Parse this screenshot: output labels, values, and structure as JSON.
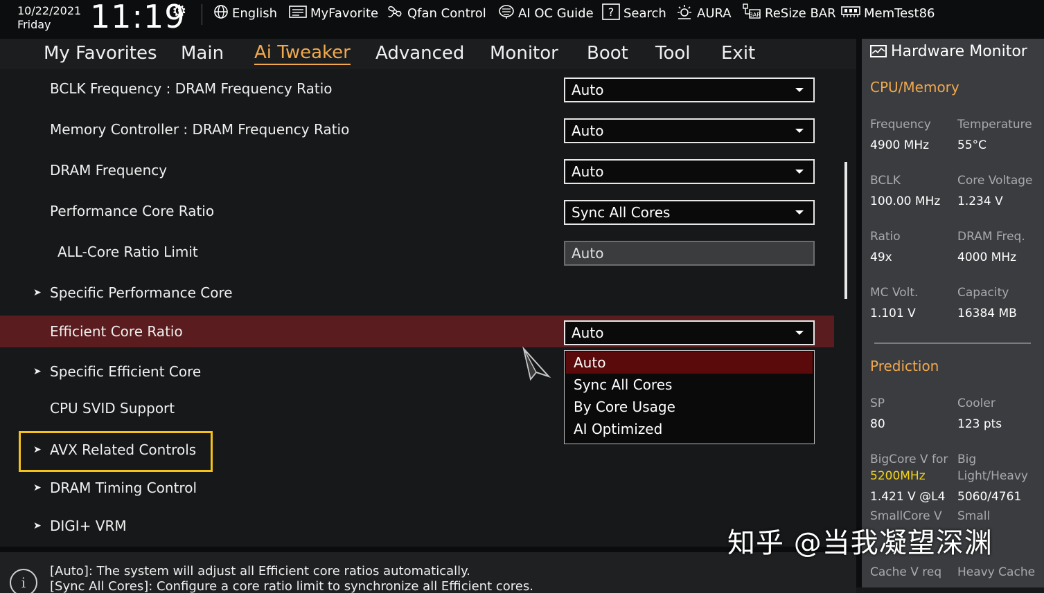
{
  "topbar": {
    "date": "10/22/2021",
    "day": "Friday",
    "time": "11:19",
    "items": [
      {
        "icon": "globe-icon",
        "label": "English"
      },
      {
        "icon": "favorite-list-icon",
        "label": "MyFavorite"
      },
      {
        "icon": "fan-icon",
        "label": "Qfan Control"
      },
      {
        "icon": "ai-brain-icon",
        "label": "AI OC Guide"
      },
      {
        "icon": "help-search-icon",
        "label": "Search"
      },
      {
        "icon": "aura-light-icon",
        "label": "AURA"
      },
      {
        "icon": "resize-bar-icon",
        "label": "ReSize BAR"
      },
      {
        "icon": "memtest-icon",
        "label": "MemTest86"
      }
    ]
  },
  "tabs": [
    "My Favorites",
    "Main",
    "Ai Tweaker",
    "Advanced",
    "Monitor",
    "Boot",
    "Tool",
    "Exit"
  ],
  "active_tab": "Ai Tweaker",
  "settings": [
    {
      "label": "BCLK Frequency : DRAM Frequency Ratio",
      "value": "Auto"
    },
    {
      "label": "Memory Controller : DRAM Frequency Ratio",
      "value": "Auto"
    },
    {
      "label": "DRAM Frequency",
      "value": "Auto"
    },
    {
      "label": "Performance Core Ratio",
      "value": "Sync All Cores"
    },
    {
      "label": "ALL-Core Ratio Limit",
      "value": "Auto"
    },
    {
      "label": "Specific Performance Core"
    },
    {
      "label": "Efficient Core Ratio",
      "value": "Auto"
    },
    {
      "label": "Specific Efficient Core"
    },
    {
      "label": "CPU SVID Support"
    },
    {
      "label": "AVX Related Controls"
    },
    {
      "label": "DRAM Timing Control"
    },
    {
      "label": "DIGI+ VRM"
    }
  ],
  "dropdown_options": [
    "Auto",
    "Sync All Cores",
    "By Core Usage",
    "AI Optimized"
  ],
  "dropdown_selected": "Auto",
  "help": [
    "[Auto]: The system will adjust all Efficient core ratios automatically.",
    "[Sync All Cores]: Configure a core ratio limit to synchronize all Efficient cores."
  ],
  "hw": {
    "title": "Hardware Monitor",
    "cpu_section": "CPU/Memory",
    "cpu": [
      {
        "k": "Frequency",
        "v": "4900 MHz"
      },
      {
        "k": "Temperature",
        "v": "55°C"
      },
      {
        "k": "BCLK",
        "v": "100.00 MHz"
      },
      {
        "k": "Core Voltage",
        "v": "1.234 V"
      },
      {
        "k": "Ratio",
        "v": "49x"
      },
      {
        "k": "DRAM Freq.",
        "v": "4000 MHz"
      },
      {
        "k": "MC Volt.",
        "v": "1.101 V"
      },
      {
        "k": "Capacity",
        "v": "16384 MB"
      }
    ],
    "pred_section": "Prediction",
    "pred": {
      "sp_k": "SP",
      "sp_v": "80",
      "cooler_k": "Cooler",
      "cooler_v": "123 pts",
      "bigcore_k": "BigCore V for",
      "bigcore_freq": "5200MHz",
      "bigcore_v": "1.421 V @L4",
      "big_k1": "Big",
      "big_k2": "Light/Heavy",
      "big_v": "5060/4761",
      "smallcore_k": "SmallCore V",
      "small_k": "Small",
      "cache_k": "Cache V req",
      "heavycache_k": "Heavy Cache"
    }
  },
  "watermark": "知乎 @当我凝望深渊"
}
